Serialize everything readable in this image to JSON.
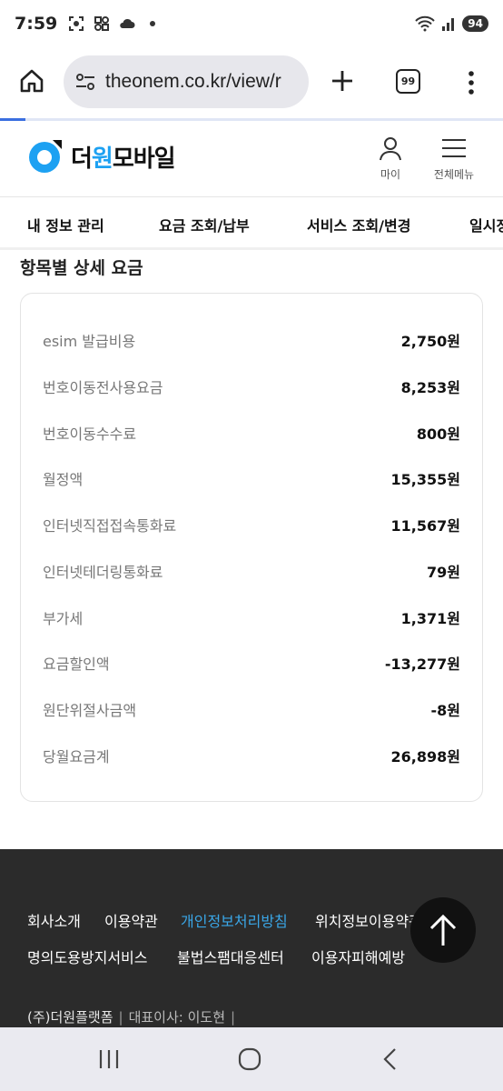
{
  "status_bar": {
    "time": "7:59",
    "battery": "94",
    "icons": [
      "screenshot-icon",
      "barcode-icon",
      "cloud-icon",
      "dot-icon",
      "wifi-icon",
      "signal-icon",
      "battery-icon"
    ]
  },
  "browser": {
    "url": "theonem.co.kr/view/r",
    "tab_count": "99"
  },
  "header": {
    "logo_prefix": "더",
    "logo_highlight": "원",
    "logo_suffix": "모바일",
    "my_label": "마이",
    "menu_label": "전체메뉴"
  },
  "nav": {
    "items": [
      "내 정보 관리",
      "요금 조회/납부",
      "서비스 조회/변경",
      "일시정지"
    ]
  },
  "section": {
    "title": "항목별 상세 요금"
  },
  "fees": [
    {
      "label": "esim 발급비용",
      "value": "2,750원"
    },
    {
      "label": "번호이동전사용요금",
      "value": "8,253원"
    },
    {
      "label": "번호이동수수료",
      "value": "800원"
    },
    {
      "label": "월정액",
      "value": "15,355원"
    },
    {
      "label": "인터넷직접접속통화료",
      "value": "11,567원"
    },
    {
      "label": "인터넷테더링통화료",
      "value": "79원"
    },
    {
      "label": "부가세",
      "value": "1,371원"
    },
    {
      "label": "요금할인액",
      "value": "-13,277원"
    },
    {
      "label": "원단위절사금액",
      "value": "-8원"
    },
    {
      "label": "당월요금계",
      "value": "26,898원"
    }
  ],
  "footer": {
    "links_row1": [
      "회사소개",
      "이용약관",
      "개인정보처리방침",
      "위치정보이용약관"
    ],
    "links_row2": [
      "명의도용방지서비스",
      "불법스팸대응센터",
      "이용자피해예방"
    ],
    "company": "(주)더원플랫폼",
    "ceo": "대표이사: 이도현"
  },
  "colors": {
    "accent": "#1da1f2",
    "footer_bg": "#2b2b2b",
    "footer_highlight": "#3aa7e8"
  }
}
